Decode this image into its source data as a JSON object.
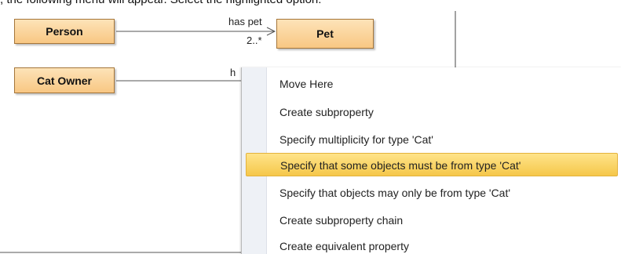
{
  "instruction": ", the following menu will appear. Select the highlighted option:",
  "diagram": {
    "classes": [
      {
        "name": "Person"
      },
      {
        "name": "Pet"
      },
      {
        "name": "Cat Owner"
      }
    ],
    "association": {
      "name": "has pet",
      "multiplicity": "2..*"
    },
    "partial_label": "h"
  },
  "menu": {
    "items": [
      {
        "label": "Move Here",
        "highlighted": false
      },
      {
        "label": "Create subproperty",
        "highlighted": false
      },
      {
        "label": "Specify multiplicity for type 'Cat'",
        "highlighted": false
      },
      {
        "label": "Specify that some objects must be from type 'Cat'",
        "highlighted": true
      },
      {
        "label": "Specify that objects may only be from type 'Cat'",
        "highlighted": false
      },
      {
        "label": "Create subproperty chain",
        "highlighted": false
      },
      {
        "label": "Create equivalent property",
        "highlighted": false
      }
    ]
  },
  "colors": {
    "class_fill": "#f8c783",
    "highlight": "#f5c74a",
    "menu_gutter": "#eef1f6"
  }
}
